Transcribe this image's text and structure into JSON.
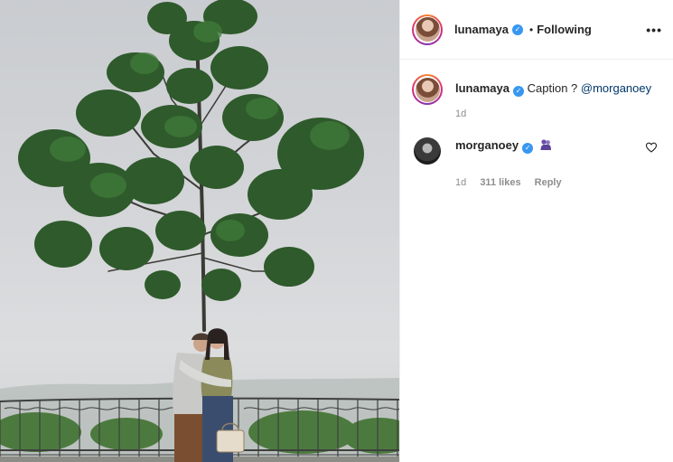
{
  "post": {
    "author": "lunamaya",
    "follow_status": "Following",
    "separator": "•",
    "more_icon": "more-horizontal-icon"
  },
  "caption": {
    "author": "lunamaya",
    "text": "Caption ? ",
    "mention": "@morganoey",
    "age": "1d"
  },
  "comments": [
    {
      "author": "morganoey",
      "emoji": "people-hugging-emoji",
      "age": "1d",
      "likes": "311 likes",
      "reply_label": "Reply",
      "like_icon": "heart-outline-icon"
    }
  ],
  "colors": {
    "verified": "#3897f0",
    "mention": "#00376b",
    "meta": "#8e8e8e",
    "text": "#262626"
  }
}
